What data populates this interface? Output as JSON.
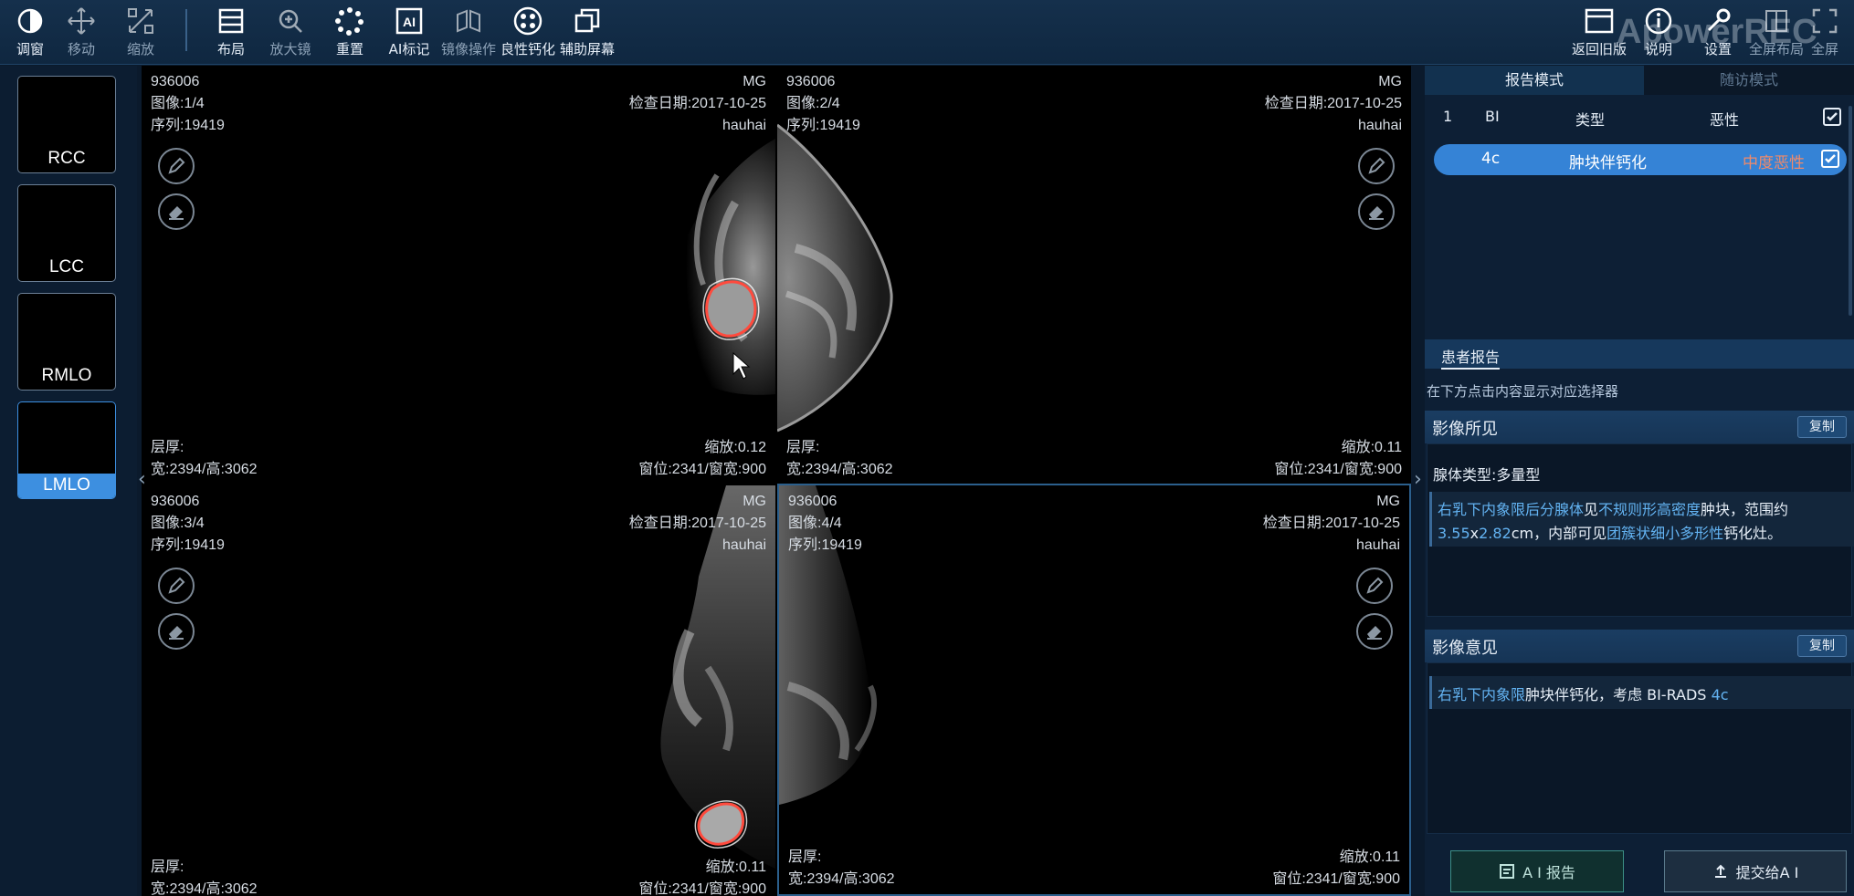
{
  "toolbar": {
    "left": [
      {
        "label": "调窗",
        "icon": "contrast-icon"
      },
      {
        "label": "移动",
        "icon": "move-icon"
      },
      {
        "label": "缩放",
        "icon": "zoom-icon"
      },
      {
        "label": "布局",
        "icon": "layout-icon"
      },
      {
        "label": "放大镜",
        "icon": "magnifier-icon"
      },
      {
        "label": "重置",
        "icon": "reset-icon"
      },
      {
        "label": "AI标记",
        "icon": "ai-mark-icon"
      },
      {
        "label": "镜像操作",
        "icon": "mirror-icon"
      },
      {
        "label": "良性钙化",
        "icon": "benign-calc-icon"
      },
      {
        "label": "辅助屏幕",
        "icon": "aux-screen-icon"
      }
    ],
    "right": [
      {
        "label": "返回旧版",
        "icon": "back-old-icon"
      },
      {
        "label": "说明",
        "icon": "info-icon"
      },
      {
        "label": "设置",
        "icon": "settings-icon"
      },
      {
        "label": "全屏布局",
        "icon": "fullscreen-layout-icon"
      },
      {
        "label": "全屏",
        "icon": "fullscreen-icon"
      }
    ],
    "watermark": "ApowerREC"
  },
  "thumbs": [
    {
      "label": "RCC"
    },
    {
      "label": "LCC"
    },
    {
      "label": "RMLO"
    },
    {
      "label": "LMLO",
      "active": true
    }
  ],
  "panes": [
    {
      "id": "936006",
      "image": "图像:1/4",
      "series": "序列:19419",
      "modality": "MG",
      "date": "检查日期:2017-10-25",
      "hospital": "hauhai",
      "thickness": "层厚:",
      "size": "宽:2394/高:3062",
      "zoom": "缩放:0.12",
      "window": "窗位:2341/窗宽:900"
    },
    {
      "id": "936006",
      "image": "图像:2/4",
      "series": "序列:19419",
      "modality": "MG",
      "date": "检查日期:2017-10-25",
      "hospital": "hauhai",
      "thickness": "层厚:",
      "size": "宽:2394/高:3062",
      "zoom": "缩放:0.11",
      "window": "窗位:2341/窗宽:900"
    },
    {
      "id": "936006",
      "image": "图像:3/4",
      "series": "序列:19419",
      "modality": "MG",
      "date": "检查日期:2017-10-25",
      "hospital": "hauhai",
      "thickness": "层厚:",
      "size": "宽:2394/高:3062",
      "zoom": "缩放:0.11",
      "window": "窗位:2341/窗宽:900"
    },
    {
      "id": "936006",
      "image": "图像:4/4",
      "series": "序列:19419",
      "modality": "MG",
      "date": "检查日期:2017-10-25",
      "hospital": "hauhai",
      "thickness": "层厚:",
      "size": "宽:2394/高:3062",
      "zoom": "缩放:0.11",
      "window": "窗位:2341/窗宽:900"
    }
  ],
  "right_panel": {
    "tab_report": "报告模式",
    "tab_followup": "随访模式",
    "list_header": {
      "num": "1",
      "bi": "BI",
      "type": "类型",
      "malignancy": "恶性"
    },
    "list_row": {
      "bi": "4c",
      "type": "肿块伴钙化",
      "malignancy": "中度恶性"
    },
    "patient_report": "患者报告",
    "hint": "在下方点击内容显示对应选择器",
    "findings": {
      "title": "影像所见",
      "copy": "复制",
      "gland_type": "腺体类型:多量型",
      "l1": {
        "a": "右乳下内象限后分腺体",
        "b": "见",
        "c": "不规则形高密度",
        "d": "肿块，范围约"
      },
      "l2": {
        "a": "3.55",
        "b": "x",
        "c": "2.82",
        "d": "cm，内部可见",
        "e": "团簇状细小多形性",
        "f": "钙化灶。"
      }
    },
    "impression": {
      "title": "影像意见",
      "copy": "复制",
      "l1": {
        "a": "右乳下内象限",
        "b": "肿块伴钙化，考虑 BI-RADS ",
        "c": "4c"
      }
    },
    "btn_ai_report": "A I 报告",
    "btn_submit": "提交给A I"
  }
}
